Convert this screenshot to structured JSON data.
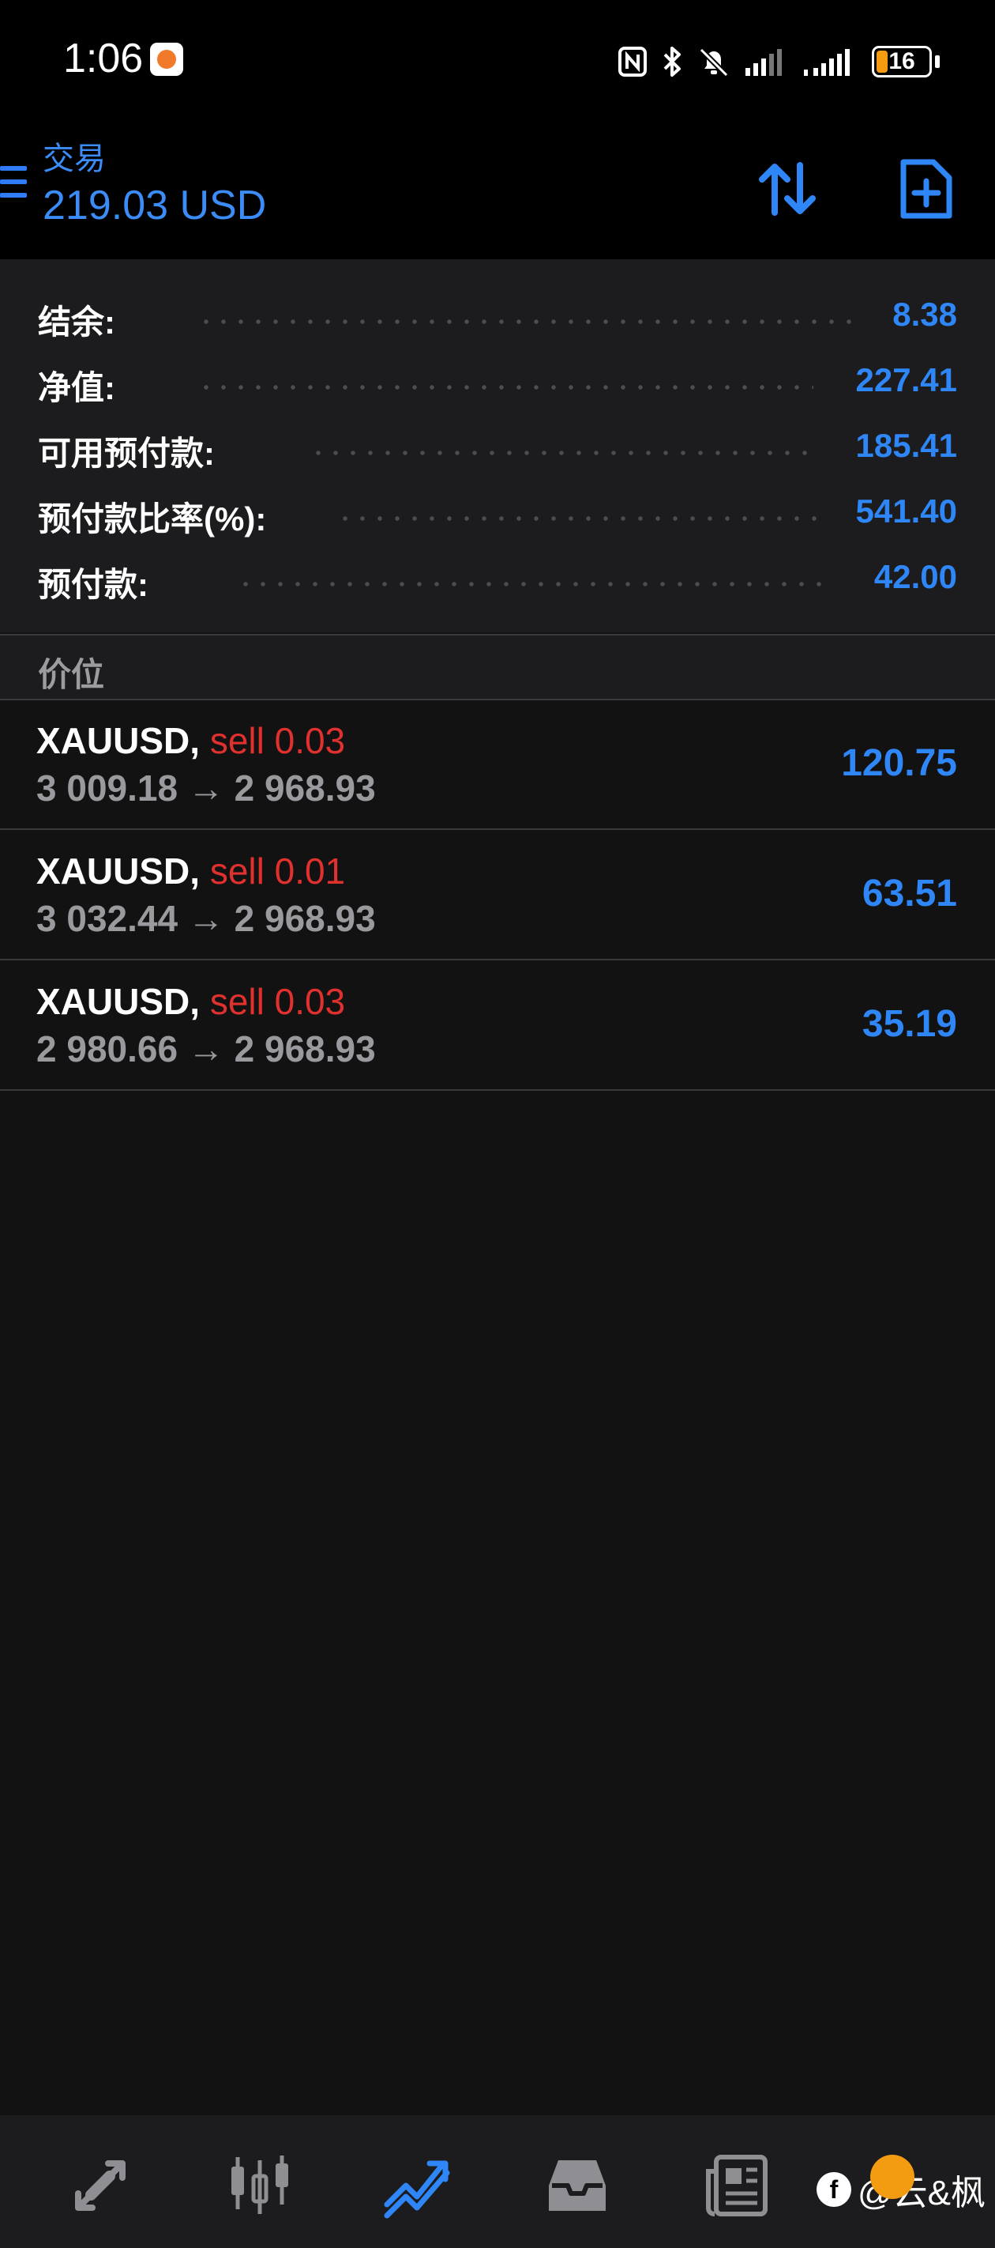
{
  "status_bar": {
    "time": "1:06",
    "battery": "16"
  },
  "header": {
    "title": "交易",
    "balance": "219.03 USD"
  },
  "summary": [
    {
      "label": "结余:",
      "value": "8.38"
    },
    {
      "label": "净值:",
      "value": "227.41"
    },
    {
      "label": "可用预付款:",
      "value": "185.41"
    },
    {
      "label": "预付款比率(%):",
      "value": "541.40"
    },
    {
      "label": "预付款:",
      "value": "42.00"
    }
  ],
  "positions_header": "价位",
  "positions": [
    {
      "symbol": "XAUUSD,",
      "side": "sell 0.03",
      "open_price": "3 009.18",
      "arrow": "→",
      "current_price": "2 968.93",
      "profit": "120.75"
    },
    {
      "symbol": "XAUUSD,",
      "side": "sell 0.01",
      "open_price": "3 032.44",
      "arrow": "→",
      "current_price": "2 968.93",
      "profit": "63.51"
    },
    {
      "symbol": "XAUUSD,",
      "side": "sell 0.03",
      "open_price": "2 980.66",
      "arrow": "→",
      "current_price": "2 968.93",
      "profit": "35.19"
    }
  ],
  "bottom_nav": [
    {
      "name": "quotes",
      "icon": "arrows-diagonal-icon",
      "active": false
    },
    {
      "name": "chart",
      "icon": "candlestick-icon",
      "active": false
    },
    {
      "name": "trade",
      "icon": "trend-line-icon",
      "active": true
    },
    {
      "name": "history",
      "icon": "inbox-icon",
      "active": false
    },
    {
      "name": "news",
      "icon": "newspaper-icon",
      "active": false
    }
  ],
  "watermark": {
    "text": "@云&枫",
    "logo": "f"
  },
  "colors": {
    "accent": "#2f86f6",
    "sell": "#e0312e",
    "muted": "#9a9a9e",
    "background": "#121212",
    "panel": "#1c1c1e"
  }
}
